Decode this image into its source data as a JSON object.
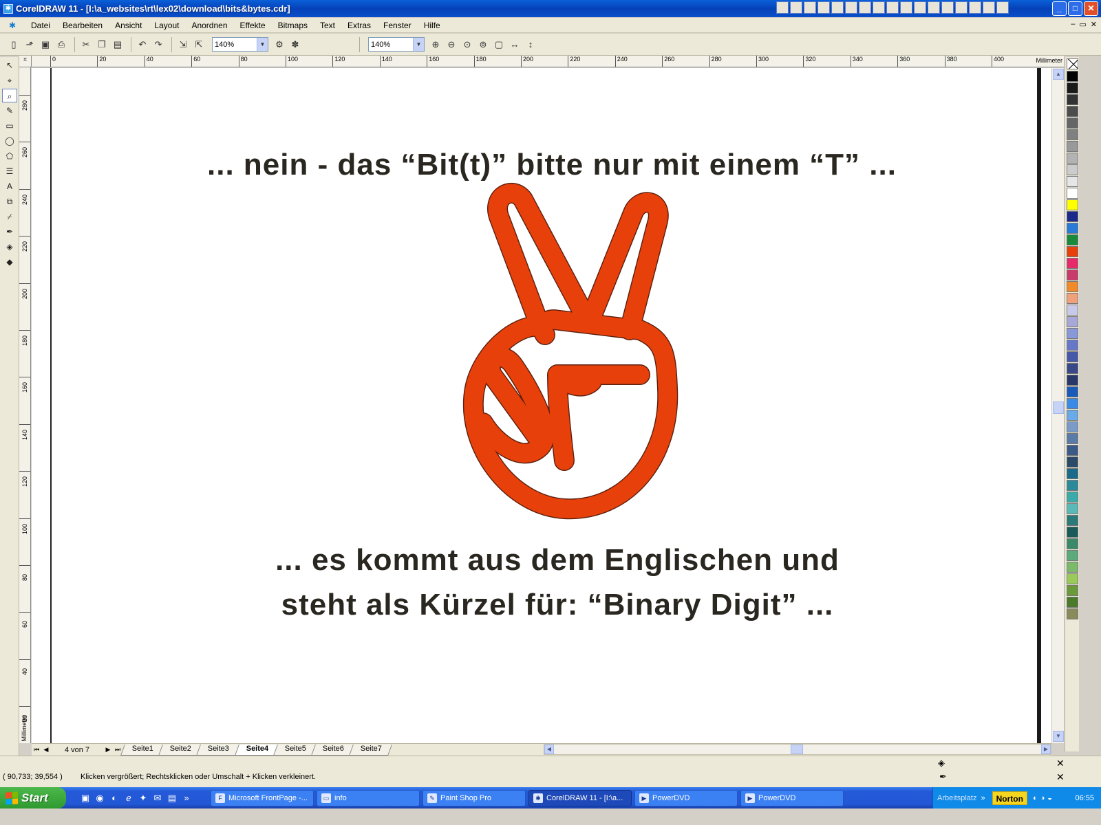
{
  "window": {
    "title": "CorelDRAW 11 - [I:\\a_websites\\rt\\lex02\\download\\bits&bytes.cdr]",
    "buttons": [
      "_",
      "□",
      "✕"
    ]
  },
  "menubar": {
    "items": [
      "Datei",
      "Bearbeiten",
      "Ansicht",
      "Layout",
      "Anordnen",
      "Effekte",
      "Bitmaps",
      "Text",
      "Extras",
      "Fenster",
      "Hilfe"
    ],
    "doc_buttons": [
      "–",
      "▭",
      "✕"
    ]
  },
  "toolbar": {
    "zoom_left": "140%",
    "zoom_right": "140%"
  },
  "ruler": {
    "unit": "Millimeter",
    "h_ticks": [
      "0",
      "20",
      "40",
      "60",
      "80",
      "100",
      "120",
      "140",
      "160",
      "180",
      "200",
      "220",
      "240",
      "260",
      "280",
      "300",
      "320",
      "340",
      "360",
      "380",
      "400"
    ],
    "v_ticks": [
      "280",
      "260",
      "240",
      "220",
      "200",
      "180",
      "160",
      "140",
      "120",
      "100",
      "80",
      "60",
      "40",
      "20"
    ],
    "v_unit": "Millimeter"
  },
  "canvas": {
    "headline": "... nein - das “Bit(t)” bitte nur mit einem “T” ...",
    "line2": "... es kommt aus dem Englischen und",
    "line3": "steht als Kürzel für: “Binary Digit” ...",
    "hand_color": "#e8400a"
  },
  "pages": {
    "counter": "4 von 7",
    "tabs": [
      "Seite1",
      "Seite2",
      "Seite3",
      "Seite4",
      "Seite5",
      "Seite6",
      "Seite7"
    ],
    "active": "Seite4"
  },
  "status": {
    "coords": "( 90,733; 39,554 )",
    "hint": "Klicken vergrößert; Rechtsklicken oder Umschalt + Klicken verkleinert."
  },
  "palette": [
    "#000000",
    "#1a1a1a",
    "#333333",
    "#4d4d4d",
    "#666666",
    "#808080",
    "#999999",
    "#b3b3b3",
    "#cccccc",
    "#e6e6e6",
    "#ffffff",
    "#ffff00",
    "#1a2a8a",
    "#2a7ad8",
    "#1a8a3a",
    "#e8400a",
    "#e82a6a",
    "#c83a6a",
    "#f08a2a",
    "#f0a07a",
    "#c8c8e8",
    "#a8a8d8",
    "#8898d8",
    "#6878c8",
    "#4858a8",
    "#384888",
    "#283868",
    "#1a5ab8",
    "#3a8ae8",
    "#6aaae8",
    "#7a9ac8",
    "#5a7aa8",
    "#3a5a88",
    "#2a4a68",
    "#1a6a8a",
    "#2a8a9a",
    "#3aaaaa",
    "#5abab8",
    "#2a7a7a",
    "#1a5a5a",
    "#3a8a6a",
    "#5aaa7a",
    "#7aba6a",
    "#9aca5a",
    "#6a9a3a",
    "#4a7a2a",
    "#8a8a5a"
  ],
  "taskbar": {
    "start": "Start",
    "tasks": [
      "Microsoft FrontPage -...",
      "info",
      "Paint Shop Pro",
      "CorelDRAW 11 - [I:\\a...",
      "PowerDVD",
      "PowerDVD"
    ],
    "active_task": "CorelDRAW 11 - [I:\\a...",
    "tray_label": "Arbeitsplatz",
    "norton": "Norton",
    "clock": "06:55"
  }
}
